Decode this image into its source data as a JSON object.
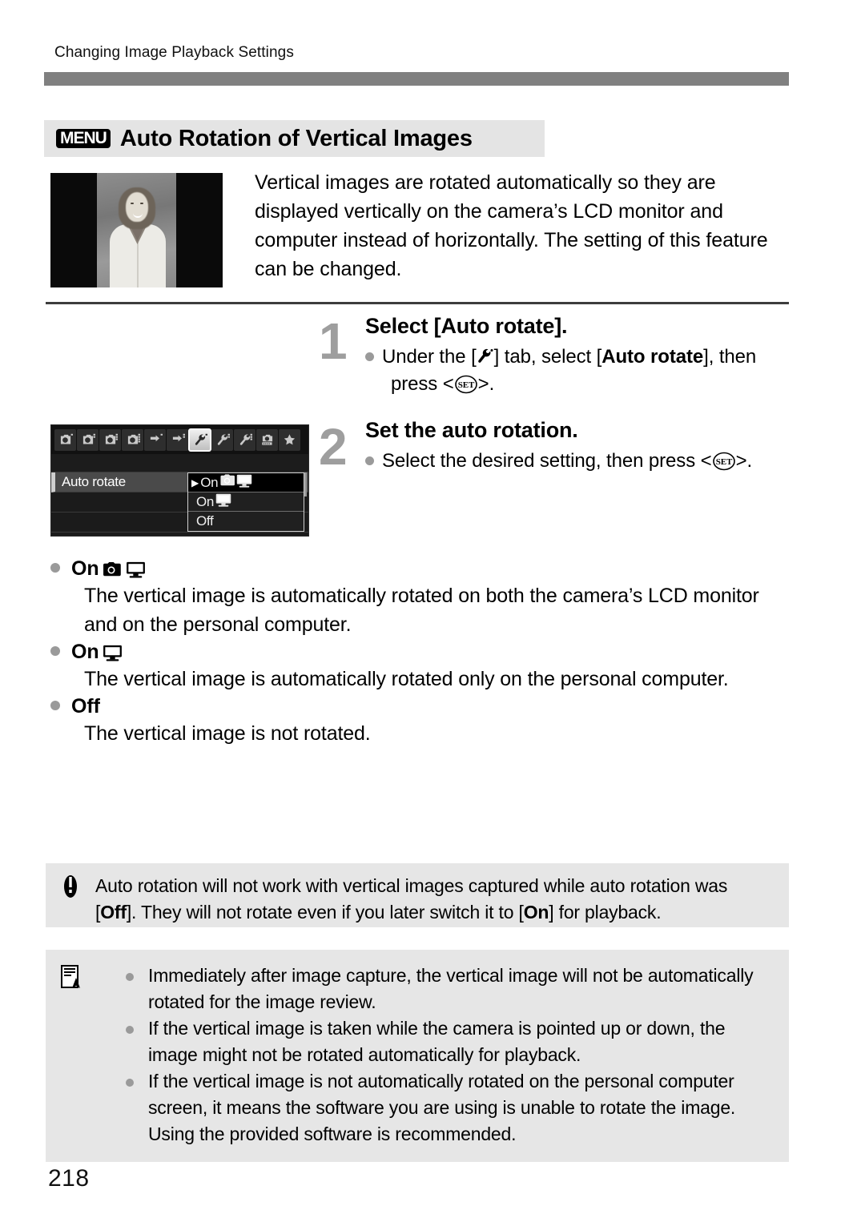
{
  "header": {
    "running_title": "Changing Image Playback Settings"
  },
  "section": {
    "menu_badge": "MENU",
    "title": "Auto Rotation of Vertical Images"
  },
  "intro": {
    "paragraph": "Vertical images are rotated automatically so they are displayed vertically on the camera’s LCD monitor and computer instead of horizontally. The setting of this feature can be changed."
  },
  "steps": [
    {
      "number": "1",
      "title": "Select [Auto rotate].",
      "body_pre": "Under the [",
      "body_mid": "] tab, select [",
      "body_bold": "Auto rotate",
      "body_post": "], then press <",
      "body_end": ">."
    },
    {
      "number": "2",
      "title": "Set the auto rotation.",
      "body_pre": "Select the desired setting, then press <",
      "body_end": ">."
    }
  ],
  "lcd": {
    "tabs": [
      {
        "name": "shooting-tab-1",
        "type": "camera",
        "marks": 1,
        "active": false
      },
      {
        "name": "shooting-tab-2",
        "type": "camera",
        "marks": 2,
        "active": false
      },
      {
        "name": "shooting-tab-3",
        "type": "camera",
        "marks": 3,
        "active": false
      },
      {
        "name": "shooting-tab-4",
        "type": "camera",
        "marks": 4,
        "active": false
      },
      {
        "name": "playback-tab-1",
        "type": "playback",
        "marks": 1,
        "active": false
      },
      {
        "name": "playback-tab-2",
        "type": "playback",
        "marks": 2,
        "active": false
      },
      {
        "name": "setup-tab-1",
        "type": "wrench",
        "marks": 1,
        "active": true
      },
      {
        "name": "setup-tab-2",
        "type": "wrench",
        "marks": 2,
        "active": false
      },
      {
        "name": "setup-tab-3",
        "type": "wrench",
        "marks": 3,
        "active": false
      },
      {
        "name": "custom-functions-tab",
        "type": "cfn",
        "marks": 0,
        "active": false
      },
      {
        "name": "my-menu-tab",
        "type": "star",
        "marks": 0,
        "active": false
      }
    ],
    "selected_row_label": "Auto rotate",
    "options": [
      {
        "label": "On",
        "icons": [
          "camera",
          "monitor"
        ],
        "current": true
      },
      {
        "label": "On",
        "icons": [
          "monitor"
        ],
        "current": false
      },
      {
        "label": "Off",
        "icons": [],
        "current": false
      }
    ]
  },
  "option_defs": [
    {
      "label": "On",
      "icons": [
        "camera",
        "monitor"
      ],
      "description": "The vertical image is automatically rotated on both the camera’s LCD monitor and on the personal computer."
    },
    {
      "label": "On",
      "icons": [
        "monitor"
      ],
      "description": "The vertical image is automatically rotated only on the personal computer."
    },
    {
      "label": "Off",
      "icons": [],
      "description": "The vertical image is not rotated."
    }
  ],
  "caution": {
    "text_1": "Auto rotation will not work with vertical images captured while auto rotation was [",
    "bold_1": "Off",
    "text_2": "]. They will not rotate even if you later switch it to [",
    "bold_2": "On",
    "text_3": "] for playback."
  },
  "notes": [
    "Immediately after image capture, the vertical image will not be automatically rotated for the image review.",
    "If the vertical image is taken while the camera is pointed up or down, the image might not be rotated automatically for playback.",
    "If the vertical image is not automatically rotated on the personal computer screen, it means the software you are using is unable to rotate the image. Using the provided software is recommended."
  ],
  "footer": {
    "page_number": "218"
  },
  "colors": {
    "header_rule": "#808080",
    "title_band": "#e4e4e4",
    "box_bg": "#e6e6e6",
    "step_number": "#9e9e9e",
    "bullet": "#9a9a9a"
  }
}
